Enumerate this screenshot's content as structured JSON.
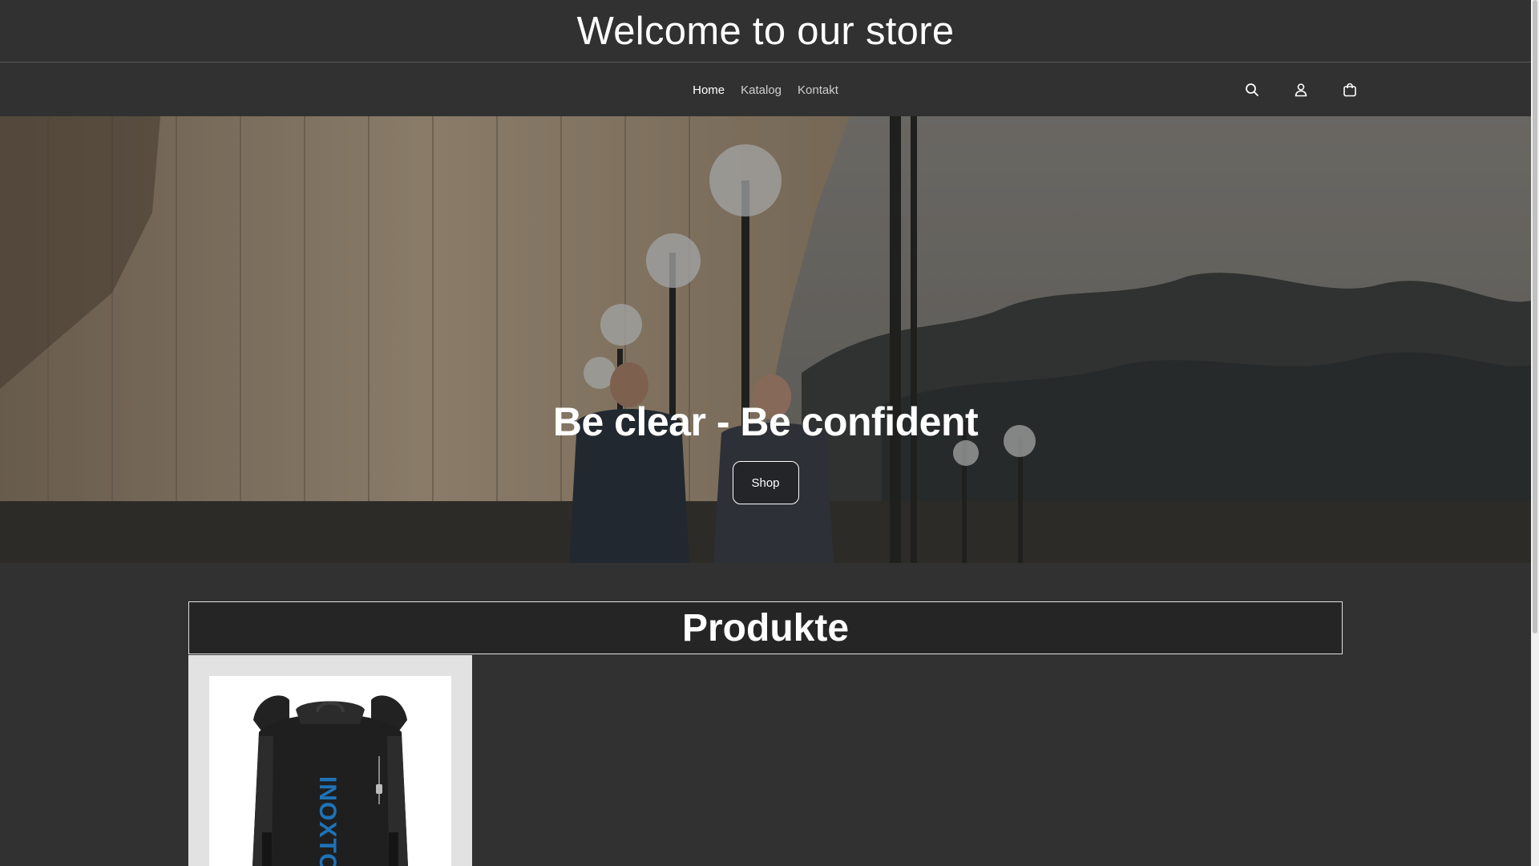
{
  "announcement": {
    "text": "Welcome to our store"
  },
  "nav": {
    "items": [
      "Home",
      "Katalog",
      "Kontakt"
    ],
    "active_index": 0
  },
  "header_icons": [
    "search-icon",
    "account-icon",
    "cart-icon"
  ],
  "hero": {
    "title": "Be clear - Be confident",
    "button_label": "Shop"
  },
  "products": {
    "heading": "Produkte",
    "product_image_text": "INOXTO"
  }
}
